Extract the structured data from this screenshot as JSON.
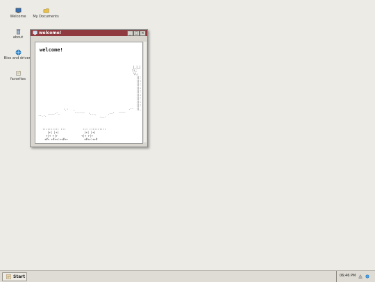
{
  "desktop": {
    "icons": [
      {
        "label": "Welcome",
        "icon": "monitor-icon"
      },
      {
        "label": "My Documents",
        "icon": "folder-icon"
      },
      {
        "label": "about",
        "icon": "trash-icon"
      },
      {
        "label": "Bios and drivers",
        "icon": "globe-icon"
      },
      {
        "label": "favorites",
        "icon": "notepad-icon"
      }
    ]
  },
  "window": {
    "title": "welcome!",
    "heading": "welcome!",
    "buttons": {
      "minimize": "_",
      "maximize": "□",
      "close": "×"
    }
  },
  "taskbar": {
    "start_label": "Start",
    "clock": "06:46 PM",
    "tray_icons": [
      "network-icon",
      "globe-icon"
    ]
  },
  "colors": {
    "desktop": "#ecebe5",
    "titlebar": "#8e3a3f",
    "taskbar": "#dedcd4"
  }
}
